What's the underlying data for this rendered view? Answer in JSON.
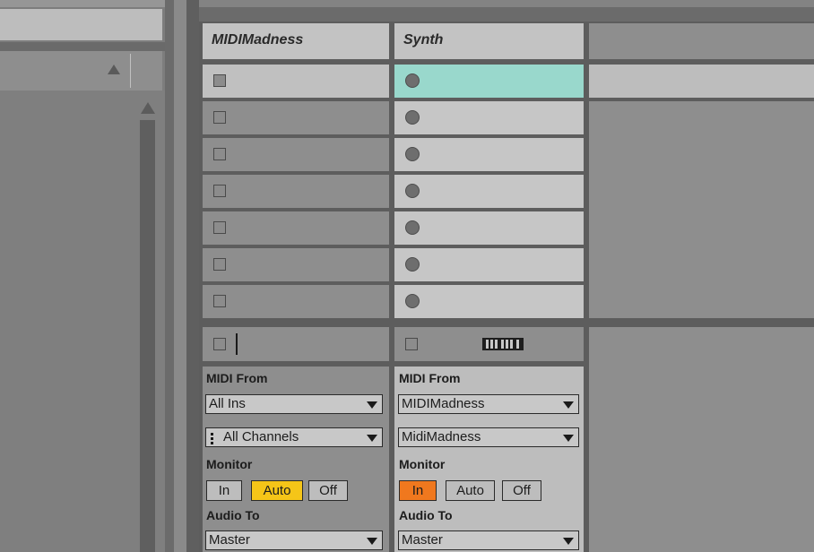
{
  "tracks": [
    {
      "name": "MIDIMadness",
      "midi_from_label": "MIDI From",
      "input_type": "All Ins",
      "input_channel": "All Channels",
      "monitor_label": "Monitor",
      "monitor": {
        "in": "In",
        "auto": "Auto",
        "off": "Off",
        "active": "Auto"
      },
      "audio_to_label": "Audio To",
      "audio_to": "Master"
    },
    {
      "name": "Synth",
      "midi_from_label": "MIDI From",
      "input_type": "MIDIMadness",
      "input_channel": "MidiMadness",
      "monitor_label": "Monitor",
      "monitor": {
        "in": "In",
        "auto": "Auto",
        "off": "Off",
        "active": "In"
      },
      "audio_to_label": "Audio To",
      "audio_to": "Master"
    }
  ],
  "selected_slot": {
    "track": 1,
    "scene": 0
  },
  "colors": {
    "auto_active": "#f5c518",
    "in_active": "#f0781e",
    "selected_slot": "#99d8cc",
    "selected_scene_row": "#bdbdbd"
  },
  "icons": {
    "stop_button": "square-stop-icon",
    "clip_slot": "circle-record-icon",
    "keyboard": "keyboard-icon",
    "dropdown": "triangle-down-icon",
    "scroll_up": "triangle-up-icon"
  }
}
